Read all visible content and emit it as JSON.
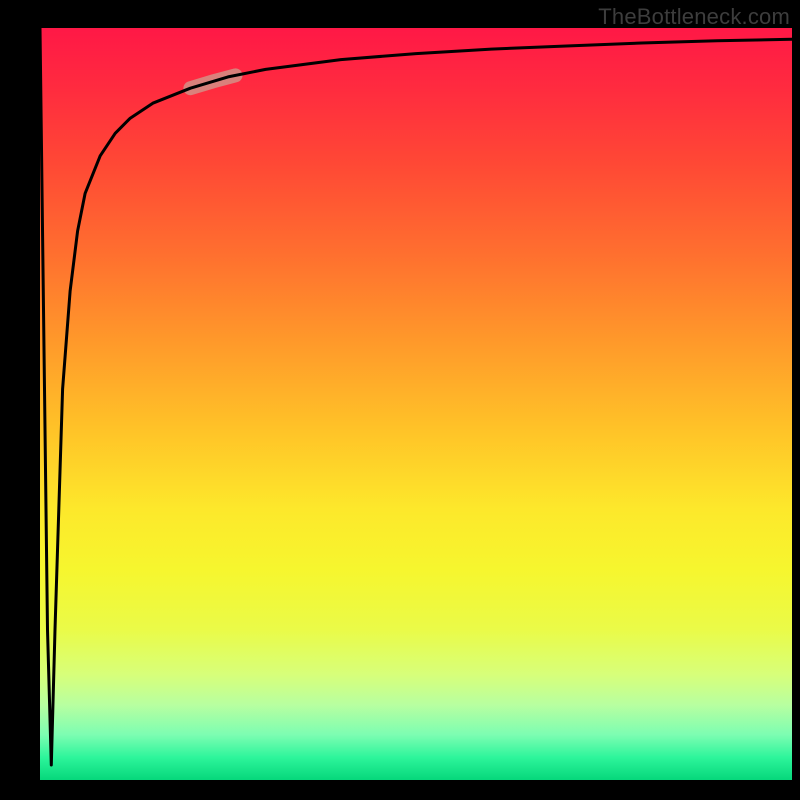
{
  "watermark": "TheBottleneck.com",
  "chart_data": {
    "type": "line",
    "title": "",
    "xlabel": "",
    "ylabel": "",
    "xlim": [
      0,
      100
    ],
    "ylim": [
      0,
      100
    ],
    "grid": false,
    "series": [
      {
        "name": "curve",
        "x": [
          0,
          1,
          1.5,
          2,
          3,
          4,
          5,
          6,
          8,
          10,
          12,
          15,
          20,
          25,
          30,
          40,
          50,
          60,
          70,
          80,
          90,
          100
        ],
        "y": [
          100,
          20,
          2,
          20,
          52,
          65,
          73,
          78,
          83,
          86,
          88,
          90,
          92,
          93.5,
          94.5,
          95.8,
          96.6,
          97.2,
          97.6,
          98,
          98.3,
          98.5
        ]
      }
    ],
    "highlight": {
      "x_range": [
        20,
        26
      ],
      "desc": "faded pink segment on curve"
    },
    "gradient": {
      "top": "#ff1846",
      "middle": "#fde82b",
      "bottom": "#06d77b"
    }
  }
}
